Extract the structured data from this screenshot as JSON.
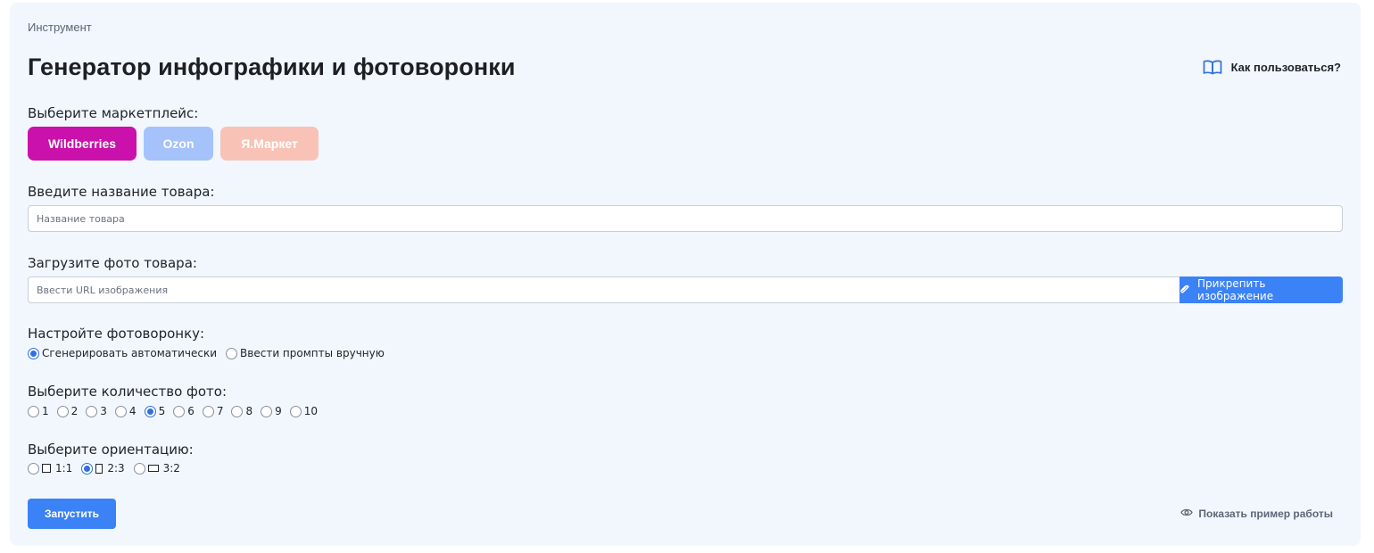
{
  "breadcrumb": "Инструмент",
  "page_title": "Генератор инфографики и фотоворонки",
  "help_link": {
    "label": "Как пользоваться?",
    "icon": "book-icon"
  },
  "marketplace": {
    "label": "Выберите маркетплейс:",
    "options": [
      "Wildberries",
      "Ozon",
      "Я.Маркет"
    ],
    "selected": "Wildberries",
    "colors": {
      "Wildberries": "#cb11ab",
      "Ozon": "#a5c2fb",
      "Я.Маркет": "#f9c2b6"
    }
  },
  "product_name": {
    "label": "Введите название товара:",
    "placeholder": "Название товара",
    "value": ""
  },
  "product_photo": {
    "label": "Загрузите фото товара:",
    "placeholder": "Ввести URL изображения",
    "value": "",
    "attach_label": "Прикрепить изображение",
    "attach_icon": "paperclip-icon"
  },
  "funnel": {
    "label": "Настройте фотоворонку:",
    "options": [
      "Сгенерировать автоматически",
      "Ввести промпты вручную"
    ],
    "selected": "Сгенерировать автоматически"
  },
  "photo_count": {
    "label": "Выберите количество фото:",
    "options": [
      "1",
      "2",
      "3",
      "4",
      "5",
      "6",
      "7",
      "8",
      "9",
      "10"
    ],
    "selected": "5"
  },
  "orientation": {
    "label": "Выберите ориентацию:",
    "options": [
      {
        "value": "1:1",
        "icon": "square-icon"
      },
      {
        "value": "2:3",
        "icon": "portrait-icon"
      },
      {
        "value": "3:2",
        "icon": "landscape-icon"
      }
    ],
    "selected": "2:3"
  },
  "run_button": "Запустить",
  "example_link": {
    "label": "Показать пример работы",
    "icon": "eye-icon"
  },
  "accent_color": "#3b82f6",
  "background_color": "#f2f7fe"
}
